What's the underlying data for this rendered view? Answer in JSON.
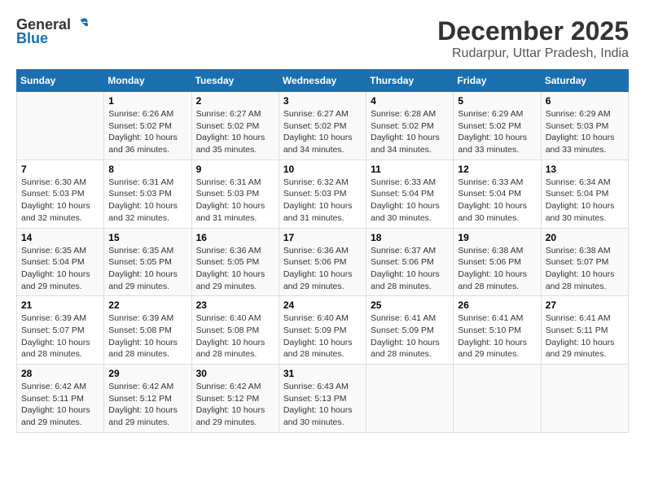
{
  "logo": {
    "general": "General",
    "blue": "Blue"
  },
  "title": {
    "month": "December 2025",
    "location": "Rudarpur, Uttar Pradesh, India"
  },
  "headers": [
    "Sunday",
    "Monday",
    "Tuesday",
    "Wednesday",
    "Thursday",
    "Friday",
    "Saturday"
  ],
  "weeks": [
    [
      {
        "day": "",
        "info": ""
      },
      {
        "day": "1",
        "info": "Sunrise: 6:26 AM\nSunset: 5:02 PM\nDaylight: 10 hours\nand 36 minutes."
      },
      {
        "day": "2",
        "info": "Sunrise: 6:27 AM\nSunset: 5:02 PM\nDaylight: 10 hours\nand 35 minutes."
      },
      {
        "day": "3",
        "info": "Sunrise: 6:27 AM\nSunset: 5:02 PM\nDaylight: 10 hours\nand 34 minutes."
      },
      {
        "day": "4",
        "info": "Sunrise: 6:28 AM\nSunset: 5:02 PM\nDaylight: 10 hours\nand 34 minutes."
      },
      {
        "day": "5",
        "info": "Sunrise: 6:29 AM\nSunset: 5:02 PM\nDaylight: 10 hours\nand 33 minutes."
      },
      {
        "day": "6",
        "info": "Sunrise: 6:29 AM\nSunset: 5:03 PM\nDaylight: 10 hours\nand 33 minutes."
      }
    ],
    [
      {
        "day": "7",
        "info": "Sunrise: 6:30 AM\nSunset: 5:03 PM\nDaylight: 10 hours\nand 32 minutes."
      },
      {
        "day": "8",
        "info": "Sunrise: 6:31 AM\nSunset: 5:03 PM\nDaylight: 10 hours\nand 32 minutes."
      },
      {
        "day": "9",
        "info": "Sunrise: 6:31 AM\nSunset: 5:03 PM\nDaylight: 10 hours\nand 31 minutes."
      },
      {
        "day": "10",
        "info": "Sunrise: 6:32 AM\nSunset: 5:03 PM\nDaylight: 10 hours\nand 31 minutes."
      },
      {
        "day": "11",
        "info": "Sunrise: 6:33 AM\nSunset: 5:04 PM\nDaylight: 10 hours\nand 30 minutes."
      },
      {
        "day": "12",
        "info": "Sunrise: 6:33 AM\nSunset: 5:04 PM\nDaylight: 10 hours\nand 30 minutes."
      },
      {
        "day": "13",
        "info": "Sunrise: 6:34 AM\nSunset: 5:04 PM\nDaylight: 10 hours\nand 30 minutes."
      }
    ],
    [
      {
        "day": "14",
        "info": "Sunrise: 6:35 AM\nSunset: 5:04 PM\nDaylight: 10 hours\nand 29 minutes."
      },
      {
        "day": "15",
        "info": "Sunrise: 6:35 AM\nSunset: 5:05 PM\nDaylight: 10 hours\nand 29 minutes."
      },
      {
        "day": "16",
        "info": "Sunrise: 6:36 AM\nSunset: 5:05 PM\nDaylight: 10 hours\nand 29 minutes."
      },
      {
        "day": "17",
        "info": "Sunrise: 6:36 AM\nSunset: 5:06 PM\nDaylight: 10 hours\nand 29 minutes."
      },
      {
        "day": "18",
        "info": "Sunrise: 6:37 AM\nSunset: 5:06 PM\nDaylight: 10 hours\nand 28 minutes."
      },
      {
        "day": "19",
        "info": "Sunrise: 6:38 AM\nSunset: 5:06 PM\nDaylight: 10 hours\nand 28 minutes."
      },
      {
        "day": "20",
        "info": "Sunrise: 6:38 AM\nSunset: 5:07 PM\nDaylight: 10 hours\nand 28 minutes."
      }
    ],
    [
      {
        "day": "21",
        "info": "Sunrise: 6:39 AM\nSunset: 5:07 PM\nDaylight: 10 hours\nand 28 minutes."
      },
      {
        "day": "22",
        "info": "Sunrise: 6:39 AM\nSunset: 5:08 PM\nDaylight: 10 hours\nand 28 minutes."
      },
      {
        "day": "23",
        "info": "Sunrise: 6:40 AM\nSunset: 5:08 PM\nDaylight: 10 hours\nand 28 minutes."
      },
      {
        "day": "24",
        "info": "Sunrise: 6:40 AM\nSunset: 5:09 PM\nDaylight: 10 hours\nand 28 minutes."
      },
      {
        "day": "25",
        "info": "Sunrise: 6:41 AM\nSunset: 5:09 PM\nDaylight: 10 hours\nand 28 minutes."
      },
      {
        "day": "26",
        "info": "Sunrise: 6:41 AM\nSunset: 5:10 PM\nDaylight: 10 hours\nand 29 minutes."
      },
      {
        "day": "27",
        "info": "Sunrise: 6:41 AM\nSunset: 5:11 PM\nDaylight: 10 hours\nand 29 minutes."
      }
    ],
    [
      {
        "day": "28",
        "info": "Sunrise: 6:42 AM\nSunset: 5:11 PM\nDaylight: 10 hours\nand 29 minutes."
      },
      {
        "day": "29",
        "info": "Sunrise: 6:42 AM\nSunset: 5:12 PM\nDaylight: 10 hours\nand 29 minutes."
      },
      {
        "day": "30",
        "info": "Sunrise: 6:42 AM\nSunset: 5:12 PM\nDaylight: 10 hours\nand 29 minutes."
      },
      {
        "day": "31",
        "info": "Sunrise: 6:43 AM\nSunset: 5:13 PM\nDaylight: 10 hours\nand 30 minutes."
      },
      {
        "day": "",
        "info": ""
      },
      {
        "day": "",
        "info": ""
      },
      {
        "day": "",
        "info": ""
      }
    ]
  ]
}
